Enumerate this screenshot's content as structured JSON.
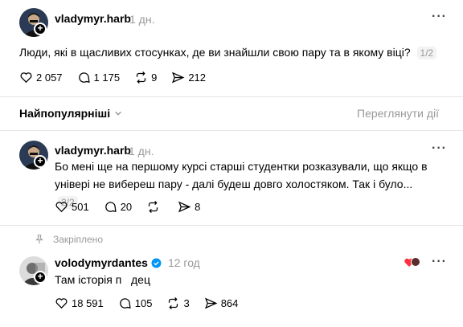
{
  "post1": {
    "username": "vladymyr.harb",
    "time": "1 дн.",
    "text": "Люди, які в щасливих стосунках, де ви знайшли свою пару та в якому віці?",
    "pager": "1/2",
    "likes": "2 057",
    "comments": "1 175",
    "reposts": "9",
    "shares": "212"
  },
  "sort": {
    "label": "Найпопулярніші",
    "view_activity": "Переглянути дії"
  },
  "post2": {
    "username": "vladymyr.harb",
    "time": "1 дн.",
    "text": "Бо мені ще на першому курсі старші студентки розказували, що якщо в універі не вибереш пару - далі будеш довго холостяком. Так і було...",
    "pager": "2/2",
    "likes": "501",
    "comments": "20",
    "shares": "8"
  },
  "reply": {
    "pinned_label": "Закріплено",
    "username": "volodymyrdantes",
    "time": "12 год",
    "text": "Там історія п   дец",
    "likes": "18 591",
    "comments": "105",
    "reposts": "3",
    "shares": "864"
  }
}
